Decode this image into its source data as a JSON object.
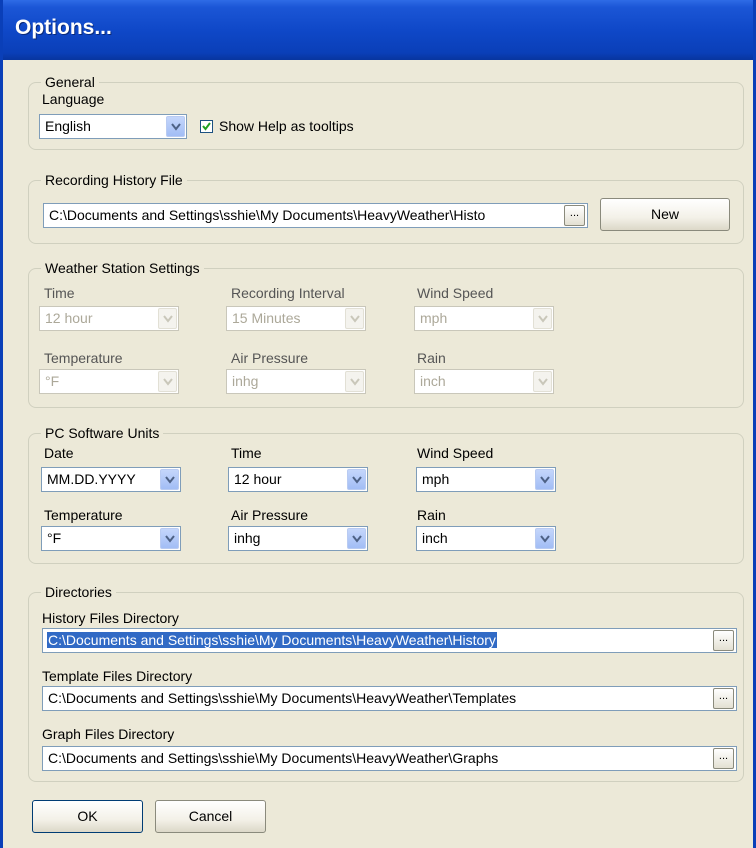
{
  "window": {
    "title": "Options..."
  },
  "general": {
    "group_label": "General",
    "language_label": "Language",
    "language_value": "English",
    "tooltips_label": "Show Help as tooltips",
    "tooltips_checked": true
  },
  "recording_history": {
    "group_label": "Recording History File",
    "path_value": "C:\\Documents and Settings\\sshie\\My Documents\\HeavyWeather\\Histo",
    "browse_label": "...",
    "new_label": "New"
  },
  "station_settings": {
    "group_label": "Weather Station Settings",
    "time_label": "Time",
    "time_value": "12 hour",
    "interval_label": "Recording Interval",
    "interval_value": "15 Minutes",
    "wind_label": "Wind Speed",
    "wind_value": "mph",
    "temp_label": "Temperature",
    "temp_value": "°F",
    "pressure_label": "Air Pressure",
    "pressure_value": "inhg",
    "rain_label": "Rain",
    "rain_value": "inch"
  },
  "pc_units": {
    "group_label": "PC Software Units",
    "date_label": "Date",
    "date_value": "MM.DD.YYYY",
    "time_label": "Time",
    "time_value": "12 hour",
    "wind_label": "Wind Speed",
    "wind_value": "mph",
    "temp_label": "Temperature",
    "temp_value": "°F",
    "pressure_label": "Air Pressure",
    "pressure_value": "inhg",
    "rain_label": "Rain",
    "rain_value": "inch"
  },
  "directories": {
    "group_label": "Directories",
    "history_label": "History Files Directory",
    "history_value": "C:\\Documents and Settings\\sshie\\My Documents\\HeavyWeather\\History",
    "template_label": "Template Files Directory",
    "template_value": "C:\\Documents and Settings\\sshie\\My Documents\\HeavyWeather\\Templates",
    "graph_label": "Graph Files Directory",
    "graph_value": "C:\\Documents and Settings\\sshie\\My Documents\\HeavyWeather\\Graphs",
    "browse_label": "..."
  },
  "buttons": {
    "ok_label": "OK",
    "cancel_label": "Cancel"
  },
  "colors": {
    "title_bar": "#0A3FB8",
    "dialog_bg": "#ECE9D8",
    "selection": "#316AC5"
  }
}
